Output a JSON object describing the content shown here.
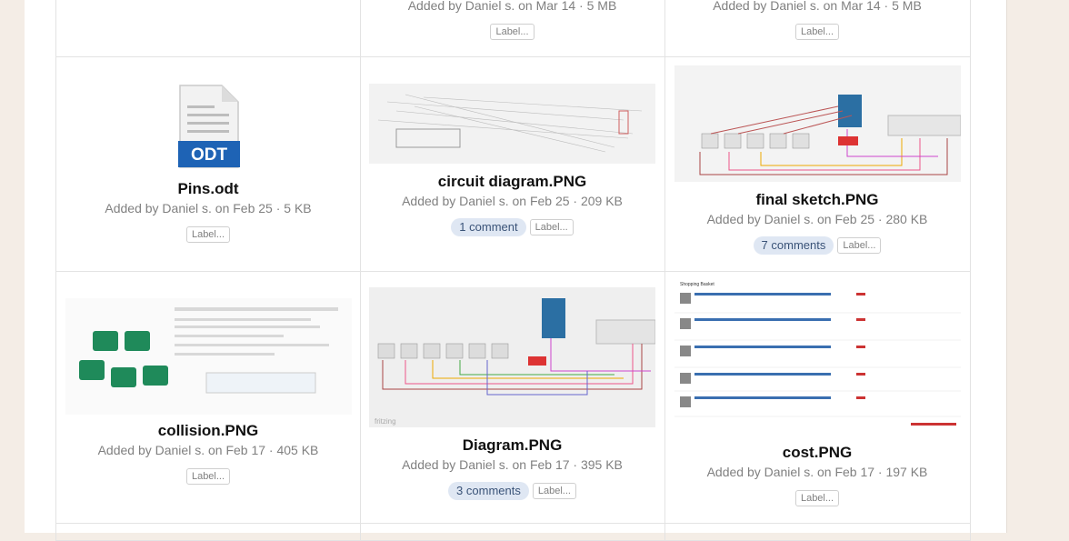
{
  "files": [
    {
      "id": "top1",
      "meta": "Added by Daniel s. on Mar 14 · 5 MB",
      "label": "Label..."
    },
    {
      "id": "top2",
      "meta": "Added by Daniel s. on Mar 14 · 5 MB",
      "label": "Label..."
    },
    {
      "id": "pins",
      "name": "Pins.odt",
      "icon_text": "ODT",
      "meta": "Added by Daniel s. on Feb 25 · 5 KB",
      "label": "Label..."
    },
    {
      "id": "circuit",
      "name": "circuit diagram.PNG",
      "meta": "Added by Daniel s. on Feb 25 · 209 KB",
      "comments": "1 comment",
      "label": "Label..."
    },
    {
      "id": "final",
      "name": "final sketch.PNG",
      "meta": "Added by Daniel s. on Feb 25 · 280 KB",
      "comments": "7 comments",
      "label": "Label..."
    },
    {
      "id": "collision",
      "name": "collision.PNG",
      "meta": "Added by Daniel s. on Feb 17 · 405 KB",
      "label": "Label..."
    },
    {
      "id": "diagram",
      "name": "Diagram.PNG",
      "meta": "Added by Daniel s. on Feb 17 · 395 KB",
      "comments": "3 comments",
      "label": "Label..."
    },
    {
      "id": "cost",
      "name": "cost.PNG",
      "meta": "Added by Daniel s. on Feb 17 · 197 KB",
      "label": "Label..."
    }
  ],
  "thumb_text": {
    "fritzing": "fritzing",
    "shopping_basket": "Shopping Basket"
  },
  "colors": {
    "pill_bg": "#dfe7f3",
    "pill_text": "#3a5378",
    "odt_blue": "#1e63b5"
  },
  "icons": {
    "odt": "odt-document-icon"
  }
}
